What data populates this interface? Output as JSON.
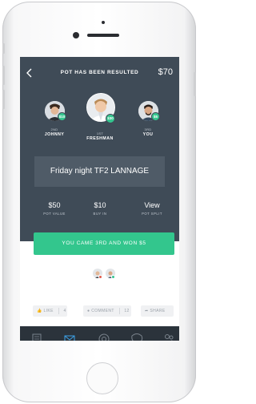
{
  "header": {
    "title": "POT HAS BEEN RESULTED",
    "amount": "$70"
  },
  "players": {
    "second": {
      "rank": "2ND",
      "name": "JOHNNY",
      "winnings": "$10"
    },
    "first": {
      "rank": "1ST",
      "name": "FRESHMAN",
      "winnings": "$30"
    },
    "third": {
      "rank": "3RD",
      "name": "YOU",
      "winnings": "$5"
    }
  },
  "pot_name": "Friday night TF2 LANNAGE",
  "stats": [
    {
      "value": "$50",
      "label": "POT VALUE"
    },
    {
      "value": "$10",
      "label": "BUY IN"
    },
    {
      "value": "View",
      "label": "POT SPLIT"
    }
  ],
  "result_button": "YOU CAME 3RD AND WON $5",
  "actions": {
    "like": {
      "label": "LIKE",
      "count": "4"
    },
    "comment": {
      "label": "COMMENT",
      "count": "12"
    },
    "share": {
      "label": "SHARE"
    }
  },
  "tabs": [
    "document-icon",
    "mail-icon",
    "settings-icon",
    "chat-icon",
    "people-icon"
  ],
  "colors": {
    "header_bg": "#3f4b57",
    "accent_green": "#33c68d",
    "tabbar_bg": "#2b333b",
    "active_tab": "#3ca0e6"
  }
}
